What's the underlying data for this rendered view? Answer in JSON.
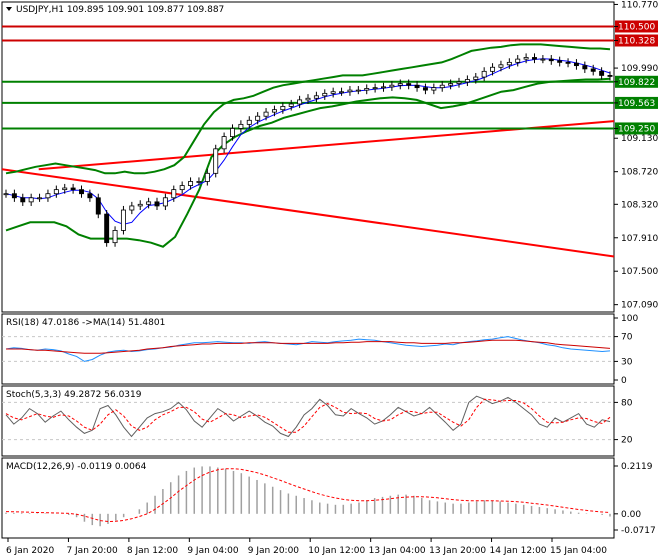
{
  "colors": {
    "background": "#ffffff",
    "frame": "#000000",
    "candle": "#000000",
    "bollinger": "#008000",
    "ma_fast": "#0000ff",
    "ma_slow": "#ff0000",
    "resistance": "#cc0000",
    "support": "#008000",
    "rsi": "#1e90ff",
    "rsi_ma": "#cc0000",
    "macd_hist": "#a0a0a0",
    "macd_signal": "#ff0000",
    "grid": "#c8c8c8"
  },
  "chart_data": [
    {
      "id": "price",
      "type": "candlestick",
      "header": "USDJPY,H1  109.895 109.901 109.877 109.887",
      "ylim": [
        107.0,
        110.8
      ],
      "y_ticks": [
        "110.770",
        "110.500",
        "110.328",
        "109.990",
        "109.822",
        "109.563",
        "109.250",
        "109.130",
        "108.720",
        "108.320",
        "107.910",
        "107.500",
        "107.090"
      ],
      "horizontal_levels": [
        {
          "value": 110.5,
          "label": "110.500",
          "kind": "resistance"
        },
        {
          "value": 110.328,
          "label": "110.328",
          "kind": "resistance"
        },
        {
          "value": 109.822,
          "label": "109.822",
          "kind": "support"
        },
        {
          "value": 109.563,
          "label": "109.563",
          "kind": "support"
        },
        {
          "value": 109.25,
          "label": "109.250",
          "kind": "support"
        }
      ],
      "last_price": 109.887,
      "trend_line_falling": {
        "from": [
          0,
          108.75
        ],
        "to": [
          1,
          107.68
        ]
      },
      "trend_line_rising": {
        "from": [
          0.06,
          108.75
        ],
        "to": [
          1,
          109.34
        ]
      },
      "series_close": [
        108.45,
        108.4,
        108.35,
        108.4,
        108.4,
        108.45,
        108.5,
        108.52,
        108.5,
        108.45,
        108.4,
        108.2,
        107.85,
        108.0,
        108.25,
        108.3,
        108.32,
        108.35,
        108.3,
        108.4,
        108.5,
        108.55,
        108.6,
        108.6,
        108.7,
        109.0,
        109.15,
        109.25,
        109.3,
        109.35,
        109.4,
        109.45,
        109.48,
        109.52,
        109.55,
        109.6,
        109.62,
        109.65,
        109.68,
        109.7,
        109.7,
        109.72,
        109.72,
        109.74,
        109.75,
        109.76,
        109.78,
        109.8,
        109.78,
        109.75,
        109.72,
        109.75,
        109.78,
        109.8,
        109.82,
        109.85,
        109.88,
        109.95,
        110.0,
        110.03,
        110.06,
        110.1,
        110.12,
        110.1,
        110.1,
        110.08,
        110.06,
        110.05,
        110.02,
        109.98,
        109.95,
        109.9,
        109.89
      ],
      "bollinger_upper": [
        108.7,
        108.72,
        108.75,
        108.78,
        108.8,
        108.82,
        108.8,
        108.78,
        108.76,
        108.74,
        108.7,
        108.7,
        108.72,
        108.7,
        108.7,
        108.72,
        108.75,
        108.8,
        108.9,
        109.1,
        109.3,
        109.45,
        109.55,
        109.6,
        109.62,
        109.65,
        109.7,
        109.75,
        109.78,
        109.8,
        109.82,
        109.84,
        109.86,
        109.88,
        109.9,
        109.9,
        109.9,
        109.92,
        109.94,
        109.96,
        109.98,
        110.0,
        110.02,
        110.04,
        110.06,
        110.1,
        110.15,
        110.2,
        110.22,
        110.24,
        110.25,
        110.27,
        110.28,
        110.28,
        110.28,
        110.27,
        110.26,
        110.25,
        110.24,
        110.23,
        110.23,
        110.22
      ],
      "bollinger_lower": [
        108.0,
        108.05,
        108.1,
        108.1,
        108.1,
        108.05,
        107.95,
        107.9,
        107.9,
        107.9,
        107.9,
        107.88,
        107.85,
        107.8,
        107.92,
        108.2,
        108.5,
        108.9,
        109.05,
        109.15,
        109.22,
        109.28,
        109.32,
        109.38,
        109.42,
        109.46,
        109.5,
        109.52,
        109.55,
        109.58,
        109.6,
        109.62,
        109.63,
        109.62,
        109.6,
        109.55,
        109.5,
        109.52,
        109.55,
        109.6,
        109.65,
        109.7,
        109.72,
        109.76,
        109.8,
        109.82,
        109.83,
        109.84,
        109.85,
        109.85,
        109.86
      ],
      "x_labels": [
        "6 Jan 2020",
        "7 Jan 20:00",
        "8 Jan 12:00",
        "9 Jan 04:00",
        "9 Jan 20:00",
        "10 Jan 12:00",
        "13 Jan 04:00",
        "13 Jan 20:00",
        "14 Jan 12:00",
        "15 Jan 04:00"
      ]
    },
    {
      "id": "rsi",
      "type": "line",
      "header": "RSI(18) 47.0186  ->MA(14) 51.4801",
      "ylim": [
        0,
        100
      ],
      "y_ticks": [
        "100",
        "70",
        "30",
        "0"
      ],
      "levels": [
        70,
        30
      ],
      "series": [
        {
          "name": "RSI(18)",
          "values": [
            50,
            52,
            51,
            49,
            48,
            50,
            49,
            47,
            42,
            38,
            30,
            33,
            40,
            45,
            47,
            48,
            46,
            47,
            49,
            50,
            52,
            53,
            56,
            58,
            60,
            60,
            61,
            62,
            61,
            60,
            60,
            59,
            61,
            62,
            60,
            59,
            58,
            57,
            59,
            62,
            61,
            60,
            62,
            63,
            64,
            66,
            65,
            64,
            62,
            60,
            58,
            56,
            55,
            54,
            55,
            56,
            58,
            57,
            60,
            62,
            63,
            65,
            66,
            68,
            70,
            67,
            64,
            62,
            60,
            57,
            55,
            52,
            50,
            49,
            48,
            47,
            46,
            47
          ]
        },
        {
          "name": "MA(14)",
          "values": [
            50,
            50,
            50,
            49,
            48,
            48,
            47,
            46,
            45,
            44,
            43,
            43,
            43,
            44,
            45,
            46,
            47,
            48,
            50,
            51,
            52,
            54,
            55,
            56,
            57,
            58,
            58,
            59,
            59,
            59,
            59,
            60,
            60,
            60,
            60,
            59,
            59,
            59,
            59,
            59,
            59,
            59,
            60,
            60,
            61,
            61,
            62,
            62,
            62,
            62,
            61,
            60,
            60,
            59,
            59,
            59,
            59,
            60,
            60,
            61,
            62,
            63,
            64,
            64,
            64,
            64,
            63,
            62,
            61,
            60,
            58,
            57,
            56,
            55,
            54,
            53,
            52,
            51
          ]
        }
      ]
    },
    {
      "id": "stoch",
      "type": "line",
      "header": "Stoch(5,3,3) 49.2872 56.0319",
      "ylim": [
        0,
        100
      ],
      "y_ticks": [
        "80",
        "20"
      ],
      "levels": [
        80,
        20
      ],
      "series": [
        {
          "name": "%K",
          "values": [
            60,
            45,
            55,
            70,
            62,
            48,
            58,
            66,
            52,
            40,
            30,
            35,
            70,
            75,
            60,
            40,
            25,
            40,
            55,
            62,
            65,
            70,
            80,
            68,
            50,
            40,
            55,
            70,
            62,
            50,
            58,
            66,
            58,
            48,
            42,
            30,
            25,
            40,
            60,
            70,
            85,
            75,
            60,
            58,
            70,
            62,
            55,
            45,
            50,
            60,
            72,
            65,
            58,
            62,
            72,
            60,
            48,
            35,
            45,
            80,
            90,
            85,
            78,
            82,
            88,
            80,
            70,
            60,
            45,
            40,
            55,
            48,
            55,
            62,
            45,
            40,
            52,
            49
          ]
        },
        {
          "name": "%D",
          "values": [
            62,
            55,
            52,
            57,
            62,
            58,
            56,
            60,
            58,
            50,
            40,
            35,
            45,
            60,
            68,
            58,
            42,
            35,
            40,
            52,
            60,
            65,
            72,
            72,
            65,
            53,
            48,
            55,
            62,
            60,
            55,
            58,
            60,
            56,
            48,
            40,
            32,
            32,
            42,
            57,
            72,
            78,
            72,
            64,
            62,
            63,
            62,
            54,
            50,
            52,
            60,
            66,
            65,
            62,
            64,
            64,
            56,
            48,
            42,
            52,
            72,
            85,
            84,
            82,
            83,
            83,
            79,
            70,
            58,
            48,
            47,
            48,
            52,
            55,
            54,
            49,
            46,
            56
          ]
        }
      ]
    },
    {
      "id": "macd",
      "type": "bar",
      "header": "MACD(12,26,9) -0.0119 0.0064",
      "ylim": [
        -0.0717,
        0.2119
      ],
      "y_ticks": [
        "0.2119",
        "0.00",
        "-0.0717"
      ],
      "series": [
        {
          "name": "MACD",
          "values": [
            0.005,
            0.004,
            0.003,
            0.003,
            0.002,
            0.002,
            0.001,
            0.0,
            -0.005,
            -0.015,
            -0.035,
            -0.05,
            -0.055,
            -0.045,
            -0.03,
            -0.015,
            0.0,
            0.02,
            0.05,
            0.08,
            0.11,
            0.14,
            0.17,
            0.19,
            0.205,
            0.21,
            0.21,
            0.205,
            0.2,
            0.19,
            0.18,
            0.165,
            0.15,
            0.135,
            0.12,
            0.105,
            0.09,
            0.08,
            0.07,
            0.06,
            0.05,
            0.045,
            0.04,
            0.04,
            0.045,
            0.05,
            0.06,
            0.07,
            0.075,
            0.08,
            0.085,
            0.085,
            0.08,
            0.07,
            0.06,
            0.055,
            0.05,
            0.045,
            0.045,
            0.05,
            0.055,
            0.06,
            0.058,
            0.055,
            0.05,
            0.045,
            0.04,
            0.035,
            0.03,
            0.025,
            0.02,
            0.015,
            0.01,
            0.005,
            0.002,
            0.0,
            -0.005,
            -0.012
          ]
        },
        {
          "name": "Signal",
          "values": [
            0.01,
            0.009,
            0.008,
            0.007,
            0.006,
            0.005,
            0.004,
            0.003,
            0.002,
            -0.002,
            -0.01,
            -0.02,
            -0.03,
            -0.034,
            -0.033,
            -0.029,
            -0.022,
            -0.012,
            0.0,
            0.02,
            0.045,
            0.07,
            0.1,
            0.125,
            0.15,
            0.17,
            0.185,
            0.195,
            0.2,
            0.2,
            0.197,
            0.19,
            0.182,
            0.172,
            0.16,
            0.148,
            0.135,
            0.122,
            0.11,
            0.098,
            0.087,
            0.078,
            0.07,
            0.064,
            0.06,
            0.058,
            0.058,
            0.06,
            0.063,
            0.067,
            0.071,
            0.074,
            0.076,
            0.076,
            0.074,
            0.071,
            0.067,
            0.063,
            0.06,
            0.058,
            0.058,
            0.058,
            0.058,
            0.057,
            0.056,
            0.054,
            0.051,
            0.047,
            0.043,
            0.039,
            0.034,
            0.029,
            0.024,
            0.019,
            0.015,
            0.011,
            0.008,
            0.006
          ]
        }
      ]
    }
  ]
}
